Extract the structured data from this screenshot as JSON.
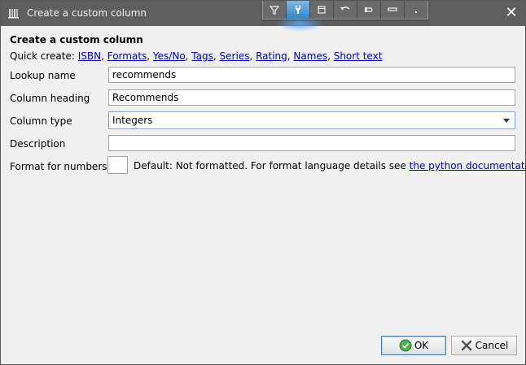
{
  "window": {
    "title": "Create a custom column"
  },
  "heading": "Create a custom column",
  "quick_create": {
    "label": "Quick create:",
    "links": [
      "ISBN",
      "Formats",
      "Yes/No",
      "Tags",
      "Series",
      "Rating",
      "Names",
      "Short text"
    ]
  },
  "fields": {
    "lookup_name": {
      "label": "Lookup name",
      "value": "recommends"
    },
    "column_heading": {
      "label": "Column heading",
      "value": "Recommends"
    },
    "column_type": {
      "label": "Column type",
      "value": "Integers"
    },
    "description": {
      "label": "Description",
      "value": ""
    },
    "format_numbers": {
      "label": "Format for numbers",
      "value": "",
      "help_text": "Default: Not formatted. For format language details see",
      "help_link": "the python documentation"
    }
  },
  "buttons": {
    "ok": "OK",
    "cancel": "Cancel"
  },
  "icons": {
    "app": "calibre-library-icon",
    "close": "close-icon",
    "ok": "check-circle-icon",
    "cancel": "x-icon"
  },
  "colors": {
    "titlebar": "#5f5f5f",
    "link": "#0000cc",
    "accent": "#2f86c9"
  }
}
